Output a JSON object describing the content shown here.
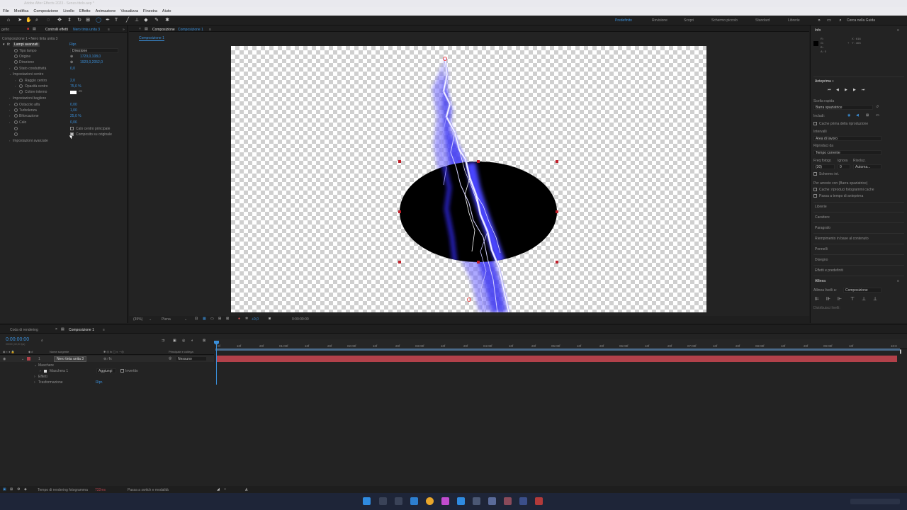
{
  "app": {
    "title": "Adobe After Effects 2023 - Senza titolo.aep *"
  },
  "menu": [
    "File",
    "Modifica",
    "Composizione",
    "Livello",
    "Effetto",
    "Animazione",
    "Visualizza",
    "Finestra",
    "Aiuto"
  ],
  "workspaces": [
    "Predefinito",
    "Revisione",
    "Scopri",
    "Schermo piccolo",
    "Standard",
    "Librerie"
  ],
  "search_placeholder": "Cerca nella Guida",
  "effect_controls": {
    "tab_left": "getto",
    "tab_label": "Controlli effetti",
    "tab_layer": "Nero tinta unita 3",
    "breadcrumb": "Composizione 1 • Nero tinta unita 3",
    "effect_name": "Lampi avanzati",
    "reset": "Ripr.",
    "properties": [
      {
        "name": "Tipo lampo",
        "value": "Direzione"
      },
      {
        "name": "Origine",
        "value": "1720,0,108,0"
      },
      {
        "name": "Direzione",
        "value": "1920,0,2052,0"
      },
      {
        "name": "Stato conduttività",
        "value": "0,0"
      },
      {
        "name": "Impostazioni centro",
        "value": ""
      },
      {
        "name": "Raggio centro",
        "value": "2,0"
      },
      {
        "name": "Opacità centro",
        "value": "75,0 %"
      },
      {
        "name": "Colore interno",
        "value": ""
      },
      {
        "name": "Impostazioni bagliore",
        "value": ""
      },
      {
        "name": "Ostacolo alfa",
        "value": "0,00"
      },
      {
        "name": "Turbolenza",
        "value": "1,00"
      },
      {
        "name": "Biforcazione",
        "value": "25,0 %"
      },
      {
        "name": "Calo",
        "value": "0,06"
      }
    ],
    "checkbox_calo": "Calo centro principale",
    "checkbox_composito": "Composito su originale",
    "advanced": "Impostazioni avanzate"
  },
  "composition": {
    "tab_label": "Composizione",
    "tab_name": "Composizione 1",
    "sub_tab": "Composizione 1",
    "zoom": "(35%)",
    "quality": "Piena",
    "timecode": "0:00:00:00",
    "exposure": "+0,0"
  },
  "info_panel": {
    "title": "Info",
    "r": "R :",
    "g": "G :",
    "b": "B :",
    "a": "A : 0",
    "x": "X : 616",
    "y": "Y : 403"
  },
  "preview_panel": {
    "title": "Anteprima",
    "shortcut_label": "Scelta rapida",
    "shortcut_value": "Barra spaziatrice",
    "include": "Includi:",
    "cache_before": "Cache prima della riproduzione",
    "range_label": "Intervalli",
    "range_value": "Area di lavoro",
    "play_from_label": "Riproduci da",
    "play_from_value": "Tempo corrente",
    "frame_rate": "Freq fotogr.",
    "skip": "Ignora",
    "resolution": "Risoluz.",
    "frame_rate_value": "(30)",
    "skip_value": "0",
    "resolution_value": "Automa...",
    "fullscreen": "Schermo int.",
    "stop_label": "Per arresto con (Barra spaziatrice)",
    "stop_cache": "Cache: riproduci fotogrammi cache",
    "stop_pass": "Passa a tempo di anteprima"
  },
  "right_sections": [
    "Librerie",
    "Carattere",
    "Paragrafo",
    "Riempimento in base al contenuto",
    "Pennelli",
    "Disegno",
    "Effetti e predefiniti"
  ],
  "align_panel": {
    "title": "Allinea",
    "align_to_label": "Allinea livelli a:",
    "align_to_value": "Composizione",
    "distribute": "Distribuisci livelli:"
  },
  "timeline": {
    "tab_render": "Coda di rendering",
    "tab_comp": "Composizione 1",
    "timecode": "0:00:00:00",
    "timecode_sub": "00000 (30,00 fps)",
    "col_source": "Nome sorgente",
    "col_parent": "Principale e collega",
    "layer_number": "1",
    "layer_name": "Nero tinta unita 3",
    "parent_value": "Nessuno",
    "masks": "Maschere",
    "mask1": "Maschera 1",
    "mask_mode": "Aggiungi",
    "mask_inverted": "Invertito",
    "effects": "Effetti",
    "transform": "Trasformazione",
    "transform_reset": "Ripr.",
    "ruler": [
      "0f",
      "10f",
      "20f",
      "01:00f",
      "10f",
      "20f",
      "02:00f",
      "10f",
      "20f",
      "03:00f",
      "10f",
      "20f",
      "04:00f",
      "10f",
      "20f",
      "05:00f",
      "10f",
      "20f",
      "06:00f",
      "10f",
      "20f",
      "07:00f",
      "10f",
      "20f",
      "08:00f",
      "10f",
      "20f",
      "09:00f",
      "10f",
      "10:0"
    ]
  },
  "status": {
    "render_time_label": "Tempo di rendering fotogramma",
    "render_time_value": "732ms",
    "switches": "Passa a switch e modalità"
  },
  "colors": {
    "accent": "#2f7fd4",
    "layer_bar": "#b2414a",
    "lightning": "#3b35f0"
  }
}
